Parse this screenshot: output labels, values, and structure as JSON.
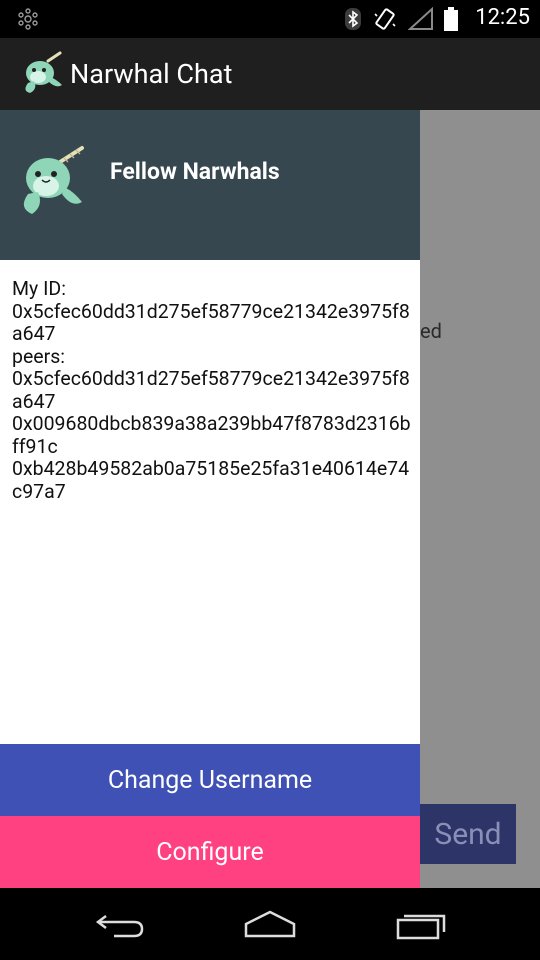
{
  "status_bar": {
    "time": "12:25",
    "icons": [
      "app-notification-icon",
      "bluetooth-icon",
      "vibrate-icon",
      "signal-icon",
      "battery-icon"
    ]
  },
  "app_bar": {
    "title": "Narwhal Chat",
    "logo": "narwhal-logo-icon"
  },
  "drawer": {
    "header_title": "Fellow Narwhals",
    "my_id_label": "My ID:",
    "my_id": "0x5cfec60dd31d275ef58779ce21342e3975f8a647",
    "peers_label": "peers:",
    "peers": [
      "0x5cfec60dd31d275ef58779ce21342e3975f8a647",
      "0x009680dbcb839a38a239bb47f8783d2316bff91c",
      "0xb428b49582ab0a75185e25fa31e40614e74c97a7"
    ],
    "change_username_label": "Change Username",
    "configure_label": "Configure"
  },
  "main": {
    "partial_text": "ed",
    "send_label": "Send"
  },
  "nav_bar": {
    "icons": [
      "back-icon",
      "home-icon",
      "recent-apps-icon"
    ]
  },
  "colors": {
    "drawer_header": "#37474f",
    "username_button": "#3f51b5",
    "configure_button": "#ff4081",
    "send_button": "#2d3568",
    "scrim": "#8f8f8f"
  }
}
